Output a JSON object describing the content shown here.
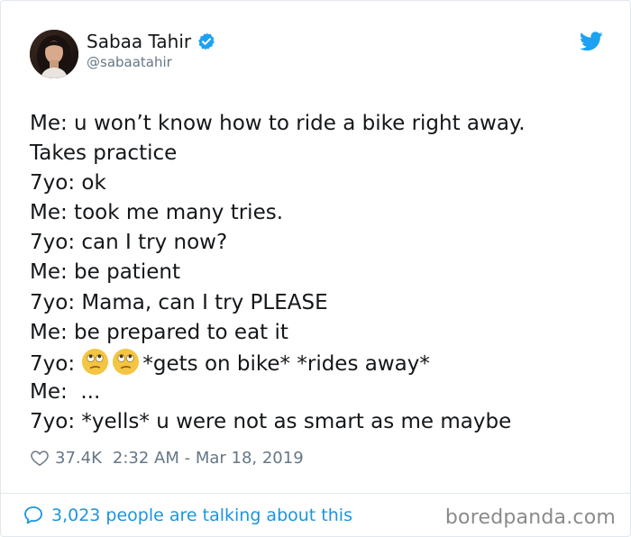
{
  "tweet": {
    "author": {
      "name": "Sabaa Tahir",
      "handle": "@sabaatahir",
      "verified": true
    },
    "lines": [
      "Me: u won’t know how to ride a bike right away.",
      "Takes practice",
      "7yo: ok",
      "Me: took me many tries.",
      "7yo: can I try now?",
      "Me: be patient",
      "7yo: Mama, can I try PLEASE",
      "Me: be prepared to eat it"
    ],
    "emoji_line": {
      "prefix": "7yo: ",
      "emoji": "eye-roll",
      "suffix": "*gets on bike* *rides away*"
    },
    "lines_after": [
      "Me:  ...",
      "7yo: *yells* u were not as smart as me maybe"
    ],
    "likes": "37.4K",
    "timestamp": "2:32 AM - Mar 18, 2019",
    "talking": "3,023 people are talking about this"
  },
  "watermark": "boredpanda.com",
  "colors": {
    "twitter_blue": "#1da1f2",
    "link_blue": "#1b95e0",
    "muted": "#657786"
  },
  "icons": [
    "verified-badge-icon",
    "twitter-bird-icon",
    "heart-icon",
    "reply-bubble-icon",
    "eye-roll-emoji"
  ]
}
